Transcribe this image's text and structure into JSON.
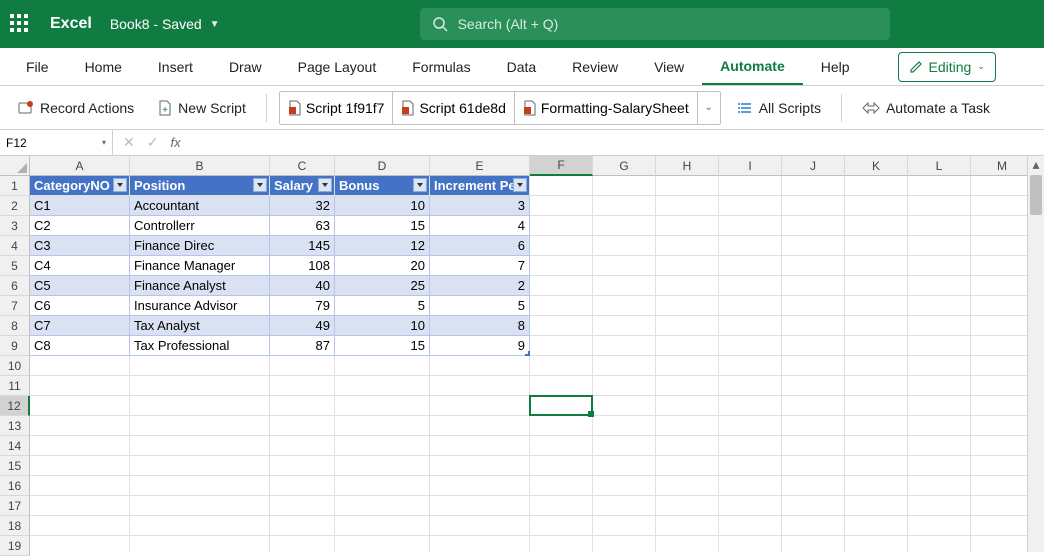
{
  "app": {
    "name": "Excel",
    "doc": "Book8 - Saved"
  },
  "search": {
    "placeholder": "Search (Alt + Q)"
  },
  "tabs": [
    "File",
    "Home",
    "Insert",
    "Draw",
    "Page Layout",
    "Formulas",
    "Data",
    "Review",
    "View",
    "Automate",
    "Help"
  ],
  "active_tab": "Automate",
  "editing_label": "Editing",
  "ribbon": {
    "record": "Record Actions",
    "new_script": "New Script",
    "scripts": [
      "Script 1f91f7",
      "Script 61de8d",
      "Formatting-SalarySheet"
    ],
    "all_scripts": "All Scripts",
    "automate_task": "Automate a Task"
  },
  "namebox": "F12",
  "fx": "fx",
  "columns": [
    "A",
    "B",
    "C",
    "D",
    "E",
    "F",
    "G",
    "H",
    "I",
    "J",
    "K",
    "L",
    "M"
  ],
  "rows": [
    1,
    2,
    3,
    4,
    5,
    6,
    7,
    8,
    9,
    10,
    11,
    12,
    13,
    14,
    15,
    16,
    17,
    18,
    19
  ],
  "table": {
    "headers": [
      "CategoryNO",
      "Position",
      "Salary",
      "Bonus",
      "Increment Pe"
    ],
    "data": [
      {
        "cat": "C1",
        "pos": "Accountant",
        "sal": 32,
        "bon": 10,
        "inc": 3
      },
      {
        "cat": "C2",
        "pos": "Controllerr",
        "sal": 63,
        "bon": 15,
        "inc": 4
      },
      {
        "cat": "C3",
        "pos": "Finance Direc",
        "sal": 145,
        "bon": 12,
        "inc": 6
      },
      {
        "cat": "C4",
        "pos": "Finance Manager",
        "sal": 108,
        "bon": 20,
        "inc": 7
      },
      {
        "cat": "C5",
        "pos": "Finance Analyst",
        "sal": 40,
        "bon": 25,
        "inc": 2
      },
      {
        "cat": "C6",
        "pos": "Insurance Advisor",
        "sal": 79,
        "bon": 5,
        "inc": 5
      },
      {
        "cat": "C7",
        "pos": "Tax Analyst",
        "sal": 49,
        "bon": 10,
        "inc": 8
      },
      {
        "cat": "C8",
        "pos": "Tax Professional",
        "sal": 87,
        "bon": 15,
        "inc": 9
      }
    ]
  },
  "active_cell": "F12"
}
